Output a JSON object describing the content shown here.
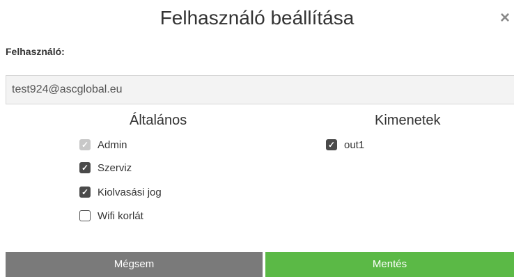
{
  "dialog": {
    "title": "Felhasználó beállítása",
    "close_symbol": "×"
  },
  "user": {
    "label": "Felhasználó:",
    "value": "test924@ascglobal.eu"
  },
  "general": {
    "heading": "Általános",
    "items": [
      {
        "label": "Admin",
        "state": "checked-disabled"
      },
      {
        "label": "Szerviz",
        "state": "checked"
      },
      {
        "label": "Kiolvasási jog",
        "state": "checked"
      },
      {
        "label": "Wifi korlát",
        "state": "unchecked"
      }
    ]
  },
  "outputs": {
    "heading": "Kimenetek",
    "items": [
      {
        "label": "out1",
        "state": "checked"
      }
    ]
  },
  "buttons": {
    "cancel_label": "Mégsem",
    "save_label": "Mentés"
  },
  "colors": {
    "save": "#5bb946",
    "cancel": "#7a7a7a",
    "checkbox_checked": "#4a4a4a",
    "checkbox_disabled": "#c8c8c8"
  }
}
